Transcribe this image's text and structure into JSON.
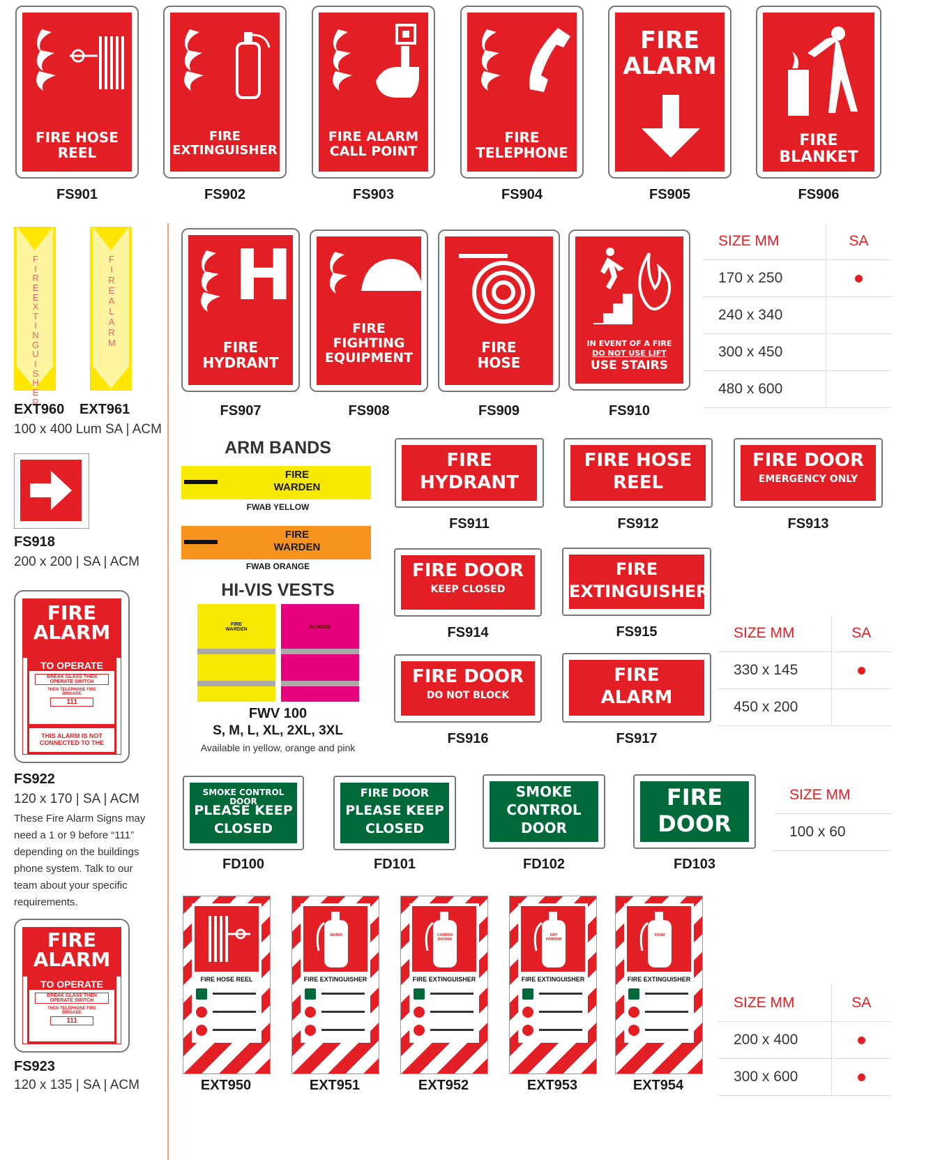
{
  "top_signs": [
    {
      "code": "FS901",
      "text": "FIRE HOSE\nREEL"
    },
    {
      "code": "FS902",
      "text": "FIRE\nEXTINGUISHER"
    },
    {
      "code": "FS903",
      "text": "FIRE ALARM\nCALL POINT"
    },
    {
      "code": "FS904",
      "text": "FIRE\nTELEPHONE"
    },
    {
      "code": "FS905",
      "text": "FIRE\nALARM"
    },
    {
      "code": "FS906",
      "text": "FIRE\nBLANKET"
    }
  ],
  "arrows": {
    "left_text": "FIRE EXTINGUISHER",
    "right_text": "FIRE ALARM",
    "code_a": "EXT960",
    "code_b": "EXT961",
    "spec": "100 x 400 Lum SA  | ACM"
  },
  "fs918": {
    "code": "FS918",
    "spec": "200 x 200  |  SA  |  ACM"
  },
  "fs922": {
    "code": "FS922",
    "spec": "120 x 170  |  SA  |  ACM",
    "note": "These Fire Alarm Signs may need a 1 or 9 before “111” depending on the buildings phone system. Talk to our team about your specific requirements.",
    "title": "FIRE\nALARM",
    "to_operate": "TO OPERATE",
    "step1": "BREAK GLASS THEN OPERATE SWITCH",
    "step2": "THEN TELEPHONE FIRE BRIGADE",
    "number": "111",
    "footer": "THIS ALARM IS NOT CONNECTED TO THE"
  },
  "fs923": {
    "code": "FS923",
    "spec": "120 x 135  |  SA  |  ACM",
    "title": "FIRE\nALARM",
    "to_operate": "TO OPERATE",
    "step1": "BREAK GLASS THEN OPERATE SWITCH",
    "step2": "THEN TELEPHONE FIRE BRIGADE",
    "number": "111"
  },
  "mid_signs": [
    {
      "code": "FS907",
      "text": "FIRE\nHYDRANT",
      "glyph": "H"
    },
    {
      "code": "FS908",
      "text": "FIRE\nFIGHTING\nEQUIPMENT"
    },
    {
      "code": "FS909",
      "text": "FIRE\nHOSE"
    },
    {
      "code": "FS910",
      "line1": "IN EVENT OF A FIRE",
      "line2": "DO NOT USE LIFT",
      "line3": "USE STAIRS"
    }
  ],
  "table1": {
    "head": [
      "SIZE MM",
      "SA"
    ],
    "rows": [
      [
        "170 x 250",
        true
      ],
      [
        "240 x 340",
        false
      ],
      [
        "300 x 450",
        false
      ],
      [
        "480 x 600",
        false
      ]
    ]
  },
  "armbands": {
    "title": "ARM BANDS",
    "yellow_text": "FIRE\nWARDEN",
    "yellow_code": "FWAB YELLOW",
    "orange_text": "FIRE\nWARDEN",
    "orange_code": "FWAB ORANGE",
    "vest_title": "HI-VIS VESTS",
    "vest_yellow_label": "FIRE\nWARDEN",
    "vest_pink_label": "WARDEN",
    "vest_code": "FWV 100",
    "vest_sizes": "S, M, L, XL, 2XL, 3XL",
    "vest_note": "Available in yellow, orange and pink"
  },
  "rect_signs": [
    {
      "code": "FS911",
      "line1": "FIRE",
      "line2": "HYDRANT"
    },
    {
      "code": "FS912",
      "line1": "FIRE HOSE",
      "line2": "REEL"
    },
    {
      "code": "FS913",
      "line1": "FIRE DOOR",
      "line2": "EMERGENCY ONLY"
    },
    {
      "code": "FS914",
      "line1": "FIRE DOOR",
      "line2": "KEEP CLOSED"
    },
    {
      "code": "FS915",
      "line1": "FIRE",
      "line2": "EXTINGUISHER"
    },
    {
      "code": "FS916",
      "line1": "FIRE DOOR",
      "line2": "DO NOT BLOCK"
    },
    {
      "code": "FS917",
      "line1": "FIRE",
      "line2": "ALARM"
    }
  ],
  "table2": {
    "head": [
      "SIZE MM",
      "SA"
    ],
    "rows": [
      [
        "330 x 145",
        true
      ],
      [
        "450 x 200",
        false
      ]
    ]
  },
  "green_signs": [
    {
      "code": "FD100",
      "line1": "SMOKE CONTROL DOOR",
      "line2": "PLEASE KEEP",
      "line3": "CLOSED"
    },
    {
      "code": "FD101",
      "line1": "FIRE DOOR",
      "line2": "PLEASE KEEP",
      "line3": "CLOSED"
    },
    {
      "code": "FD102",
      "line1": "SMOKE",
      "line2": "CONTROL",
      "line3": "DOOR"
    },
    {
      "code": "FD103",
      "line1": "FIRE",
      "line2": "DOOR"
    }
  ],
  "table3": {
    "head": [
      "SIZE MM"
    ],
    "rows": [
      [
        "100 x 60"
      ]
    ]
  },
  "ext_signs": [
    {
      "code": "EXT950",
      "title": "FIRE HOSE REEL"
    },
    {
      "code": "EXT951",
      "title": "FIRE EXTINGUISHER",
      "type": "WATER"
    },
    {
      "code": "EXT952",
      "title": "FIRE EXTINGUISHER",
      "type": "CARBON DIOXIDE"
    },
    {
      "code": "EXT953",
      "title": "FIRE EXTINGUISHER",
      "type": "DRY POWDER"
    },
    {
      "code": "EXT954",
      "title": "FIRE EXTINGUISHER",
      "type": "FOAM"
    }
  ],
  "table4": {
    "head": [
      "SIZE MM",
      "SA"
    ],
    "rows": [
      [
        "200 x 400",
        true
      ],
      [
        "300 x 600",
        true
      ]
    ]
  },
  "colors": {
    "red": "#e31e24",
    "green": "#00693a",
    "yellow": "#f7ea00",
    "orange": "#f7941d",
    "pink": "#e6007e",
    "divider": "#f0a070"
  }
}
